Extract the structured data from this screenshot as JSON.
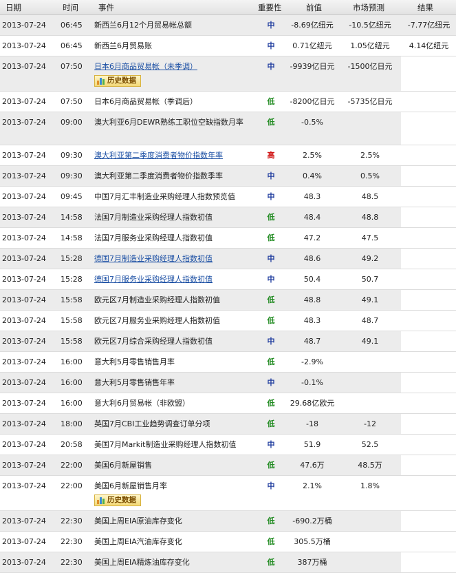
{
  "headers": {
    "date": "日期",
    "time": "时间",
    "event": "事件",
    "importance": "重要性",
    "previous": "前值",
    "forecast": "市场预测",
    "actual": "结果"
  },
  "history_label": "历史数据",
  "colors": {
    "low": "#1f8a1f",
    "mid": "#1f3c9e",
    "high": "#d01414",
    "link": "#1a4ea3",
    "alt_row": "#ececec"
  },
  "rows": [
    {
      "date": "2013-07-24",
      "time": "06:45",
      "event": "新西兰6月12个月贸易帐总额",
      "link": false,
      "importance": "中",
      "level": "mid",
      "previous": "-8.69亿纽元",
      "forecast": "-10.5亿纽元",
      "actual": "-7.77亿纽元",
      "history": false,
      "lines": 1
    },
    {
      "date": "2013-07-24",
      "time": "06:45",
      "event": "新西兰6月贸易账",
      "link": false,
      "importance": "中",
      "level": "mid",
      "previous": "0.71亿纽元",
      "forecast": "1.05亿纽元",
      "actual": "4.14亿纽元",
      "history": false,
      "lines": 1
    },
    {
      "date": "2013-07-24",
      "time": "07:50",
      "event": "日本6月商品贸易帐（未季调）",
      "link": true,
      "importance": "中",
      "level": "mid",
      "previous": "-9939亿日元",
      "forecast": "-1500亿日元",
      "actual": "",
      "history": true,
      "lines": 1
    },
    {
      "date": "2013-07-24",
      "time": "07:50",
      "event": "日本6月商品贸易帐（季调后）",
      "link": false,
      "importance": "低",
      "level": "low",
      "previous": "-8200亿日元",
      "forecast": "-5735亿日元",
      "actual": "",
      "history": false,
      "lines": 1
    },
    {
      "date": "2013-07-24",
      "time": "09:00",
      "event": "澳大利亚6月DEWR熟练工职位空缺指数月率",
      "link": false,
      "importance": "低",
      "level": "low",
      "previous": "-0.5%",
      "forecast": "",
      "actual": "",
      "history": false,
      "lines": 2
    },
    {
      "date": "2013-07-24",
      "time": "09:30",
      "event": "澳大利亚第二季度消费者物价指数年率",
      "link": true,
      "importance": "高",
      "level": "high",
      "previous": "2.5%",
      "forecast": "2.5%",
      "actual": "",
      "history": false,
      "lines": 1
    },
    {
      "date": "2013-07-24",
      "time": "09:30",
      "event": "澳大利亚第二季度消费者物价指数季率",
      "link": false,
      "importance": "中",
      "level": "mid",
      "previous": "0.4%",
      "forecast": "0.5%",
      "actual": "",
      "history": false,
      "lines": 1
    },
    {
      "date": "2013-07-24",
      "time": "09:45",
      "event": "中国7月汇丰制造业采购经理人指数预览值",
      "link": false,
      "importance": "中",
      "level": "mid",
      "previous": "48.3",
      "forecast": "48.5",
      "actual": "",
      "history": false,
      "lines": 1
    },
    {
      "date": "2013-07-24",
      "time": "14:58",
      "event": "法国7月制造业采购经理人指数初值",
      "link": false,
      "importance": "低",
      "level": "low",
      "previous": "48.4",
      "forecast": "48.8",
      "actual": "",
      "history": false,
      "lines": 1
    },
    {
      "date": "2013-07-24",
      "time": "14:58",
      "event": "法国7月服务业采购经理人指数初值",
      "link": false,
      "importance": "低",
      "level": "low",
      "previous": "47.2",
      "forecast": "47.5",
      "actual": "",
      "history": false,
      "lines": 1
    },
    {
      "date": "2013-07-24",
      "time": "15:28",
      "event": "德国7月制造业采购经理人指数初值",
      "link": true,
      "importance": "中",
      "level": "mid",
      "previous": "48.6",
      "forecast": "49.2",
      "actual": "",
      "history": false,
      "lines": 1
    },
    {
      "date": "2013-07-24",
      "time": "15:28",
      "event": "德国7月服务业采购经理人指数初值",
      "link": true,
      "importance": "中",
      "level": "mid",
      "previous": "50.4",
      "forecast": "50.7",
      "actual": "",
      "history": false,
      "lines": 1
    },
    {
      "date": "2013-07-24",
      "time": "15:58",
      "event": "欧元区7月制造业采购经理人指数初值",
      "link": false,
      "importance": "低",
      "level": "low",
      "previous": "48.8",
      "forecast": "49.1",
      "actual": "",
      "history": false,
      "lines": 1
    },
    {
      "date": "2013-07-24",
      "time": "15:58",
      "event": "欧元区7月服务业采购经理人指数初值",
      "link": false,
      "importance": "低",
      "level": "low",
      "previous": "48.3",
      "forecast": "48.7",
      "actual": "",
      "history": false,
      "lines": 1
    },
    {
      "date": "2013-07-24",
      "time": "15:58",
      "event": "欧元区7月综合采购经理人指数初值",
      "link": false,
      "importance": "中",
      "level": "mid",
      "previous": "48.7",
      "forecast": "49.1",
      "actual": "",
      "history": false,
      "lines": 1
    },
    {
      "date": "2013-07-24",
      "time": "16:00",
      "event": "意大利5月零售销售月率",
      "link": false,
      "importance": "低",
      "level": "low",
      "previous": "-2.9%",
      "forecast": "",
      "actual": "",
      "history": false,
      "lines": 1
    },
    {
      "date": "2013-07-24",
      "time": "16:00",
      "event": "意大利5月零售销售年率",
      "link": false,
      "importance": "中",
      "level": "mid",
      "previous": "-0.1%",
      "forecast": "",
      "actual": "",
      "history": false,
      "lines": 1
    },
    {
      "date": "2013-07-24",
      "time": "16:00",
      "event": "意大利6月贸易帐（非欧盟）",
      "link": false,
      "importance": "低",
      "level": "low",
      "previous": "29.68亿欧元",
      "forecast": "",
      "actual": "",
      "history": false,
      "lines": 1
    },
    {
      "date": "2013-07-24",
      "time": "18:00",
      "event": "英国7月CBI工业趋势调查订单分项",
      "link": false,
      "importance": "低",
      "level": "low",
      "previous": "-18",
      "forecast": "-12",
      "actual": "",
      "history": false,
      "lines": 1
    },
    {
      "date": "2013-07-24",
      "time": "20:58",
      "event": "美国7月Markit制造业采购经理人指数初值",
      "link": false,
      "importance": "中",
      "level": "mid",
      "previous": "51.9",
      "forecast": "52.5",
      "actual": "",
      "history": false,
      "lines": 1
    },
    {
      "date": "2013-07-24",
      "time": "22:00",
      "event": "美国6月新屋销售",
      "link": false,
      "importance": "低",
      "level": "low",
      "previous": "47.6万",
      "forecast": "48.5万",
      "actual": "",
      "history": false,
      "lines": 1
    },
    {
      "date": "2013-07-24",
      "time": "22:00",
      "event": "美国6月新屋销售月率",
      "link": false,
      "importance": "中",
      "level": "mid",
      "previous": "2.1%",
      "forecast": "1.8%",
      "actual": "",
      "history": true,
      "lines": 1
    },
    {
      "date": "2013-07-24",
      "time": "22:30",
      "event": "美国上周EIA原油库存变化",
      "link": false,
      "importance": "低",
      "level": "low",
      "previous": "-690.2万桶",
      "forecast": "",
      "actual": "",
      "history": false,
      "lines": 1
    },
    {
      "date": "2013-07-24",
      "time": "22:30",
      "event": "美国上周EIA汽油库存变化",
      "link": false,
      "importance": "低",
      "level": "low",
      "previous": "305.5万桶",
      "forecast": "",
      "actual": "",
      "history": false,
      "lines": 1
    },
    {
      "date": "2013-07-24",
      "time": "22:30",
      "event": "美国上周EIA精炼油库存变化",
      "link": false,
      "importance": "低",
      "level": "low",
      "previous": "387万桶",
      "forecast": "",
      "actual": "",
      "history": false,
      "lines": 1
    }
  ]
}
